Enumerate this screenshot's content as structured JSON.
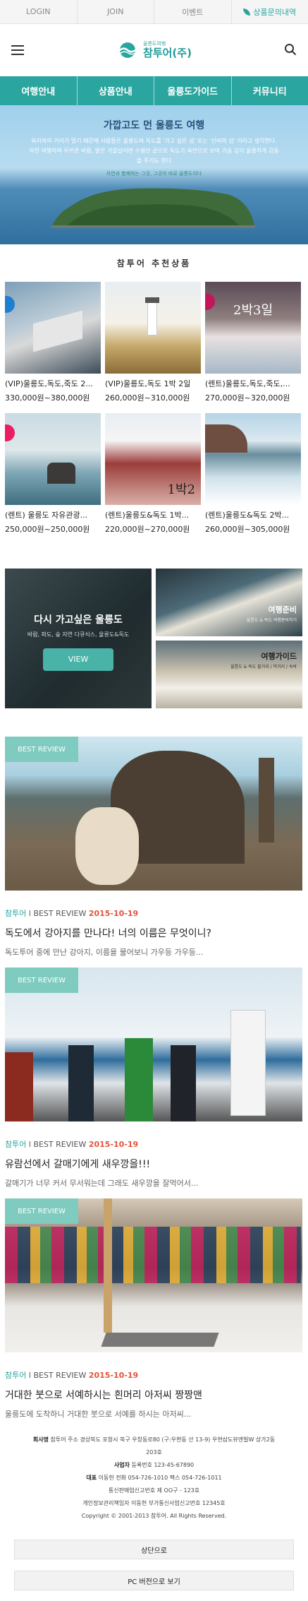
{
  "topbar": {
    "login": "LOGIN",
    "join": "JOIN",
    "event": "이벤트",
    "inquiry": "상품문의내역"
  },
  "header": {
    "logo_sub": "울릉도여행",
    "logo_main": "참투어(주)"
  },
  "gnb": [
    "여행안내",
    "상품안내",
    "울릉도가이드",
    "커뮤니티"
  ],
  "hero": {
    "title": "가깝고도 먼 울릉도 여행",
    "body": "육지와의 거리가 멀기 때문에 사람들은 울릉도와 독도를 '가고 싶은 섬' 또는 '신비의 섬' 이라고 생각한다. 자연 여행하며 무르른 바람, 맑은 가을날이면 수평선 끝으로 독도가 육안으로 보여 가슴 깊이 울릉하게 감동을 주기도 한다",
    "caption": "자연과 함께하는 그곳, 그곳이 바로 울릉도이다"
  },
  "recommend": {
    "title": "참투어 추천상품",
    "items": [
      {
        "name": "(VIP)울릉도,독도,죽도 2...",
        "price": "330,000원~380,000원"
      },
      {
        "name": "(VIP)울릉도,독도 1박 2일",
        "price": "260,000원~310,000원"
      },
      {
        "name": "(렌트)울릉도,독도,죽도,...",
        "price": "270,000원~320,000원"
      },
      {
        "name": "(렌트) 울릉도 자유관광...",
        "price": "250,000원~250,000원"
      },
      {
        "name": "(렌트)울릉도&독도 1박...",
        "price": "220,000원~270,000원"
      },
      {
        "name": "(렌트)울릉도&독도 2박...",
        "price": "260,000원~305,000원"
      }
    ],
    "overlay_texts": [
      "2박3일",
      "1박2"
    ]
  },
  "banners": {
    "main_title": "다시 가고싶은 울릉도",
    "main_sub": "바람, 파도, 숲 자연 다큐식스, 울릉도&독도",
    "view_label": "VIEW",
    "prep_title": "여행준비",
    "prep_sub": "울릉도 & 독도 여행준비하기",
    "guide_title": "여행가이드",
    "guide_sub": "울릉도 & 독도 볼거리 / 먹거리 / 숙박"
  },
  "reviews": [
    {
      "badge": "BEST REVIEW",
      "source": "참투어",
      "category": "BEST REVIEW",
      "date": "2015-10-19",
      "title": "독도에서 강아지를 만나다! 너의 이름은 무엇이니?",
      "summary": "독도투어 중에 만난 강아지, 이름을 물어보니 가우등 가우등..."
    },
    {
      "badge": "BEST REVIEW",
      "source": "참투어",
      "category": "BEST REVIEW",
      "date": "2015-10-19",
      "title": "유람선에서 갈매기에게 새우깡을!!!",
      "summary": "갈매기가 너무 커서 무서워는데 그래도 새우깡을 잘먹어서..."
    },
    {
      "badge": "BEST REVIEW",
      "source": "참투어",
      "category": "BEST REVIEW",
      "date": "2015-10-19",
      "title": "거대한 붓으로 서예하시는 흰머리 아저씨 짱짱맨",
      "summary": "울릉도에 도착하니 거대한 붓으로 서예를 하시는 아저씨..."
    }
  ],
  "footer": {
    "line1_label": "회사명",
    "line1": "참투어 주소 경상북도 포항시 북구 우창동로80 (구:우현동 산 13-9) 우현삼도뷰엔빌W 상가2동 203호",
    "line2_label": "사업자",
    "line2": "등록번호 123-45-67890",
    "line3_label": "대표",
    "line3": "이동헌 전화 054-726-1010 팩스 054-726-1011",
    "line4": "통신판매업신고번호 제 OO구 - 123호",
    "line5": "개인정보관리책임자 이동헌 부가통신사업신고번호 12345호",
    "copyright": "Copyright © 2001-2013 참투어. All Rights Reserved."
  },
  "buttons": {
    "top": "상단으로",
    "pc": "PC 버전으로 보기"
  }
}
